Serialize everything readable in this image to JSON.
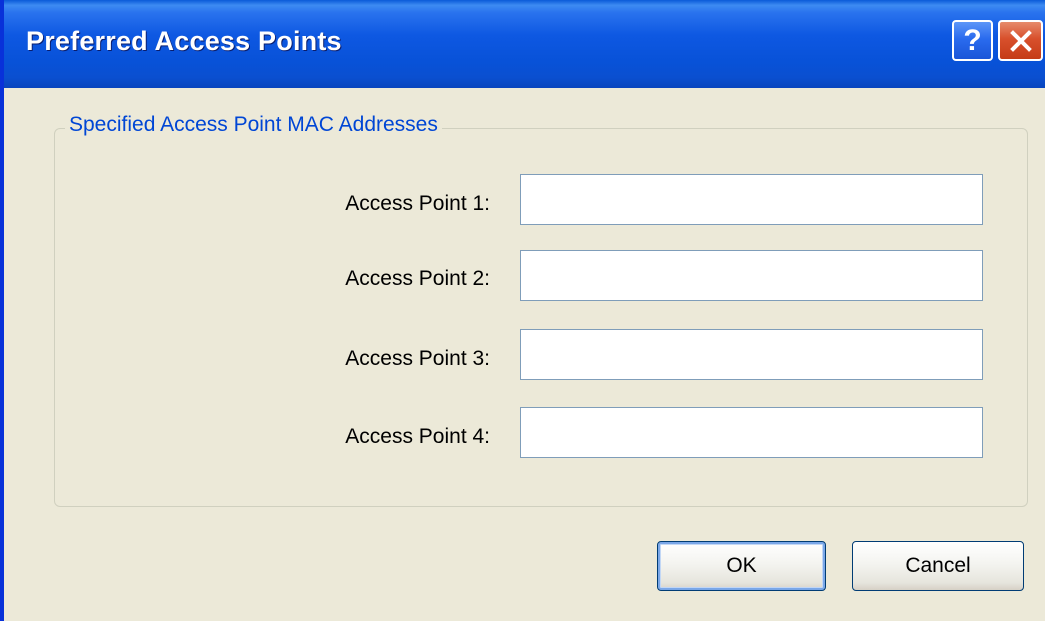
{
  "window": {
    "title": "Preferred Access Points",
    "help_glyph": "?",
    "help_icon": "question-mark-icon",
    "close_icon": "close-x-icon",
    "titlebar_color": "#0a55dc",
    "close_color": "#d8502c"
  },
  "group": {
    "legend": "Specified Access Point MAC Addresses",
    "legend_color": "#0046d5",
    "fields": [
      {
        "label": "Access Point 1:",
        "value": ""
      },
      {
        "label": "Access Point 2:",
        "value": ""
      },
      {
        "label": "Access Point 3:",
        "value": ""
      },
      {
        "label": "Access Point 4:",
        "value": ""
      }
    ]
  },
  "buttons": {
    "ok_label": "OK",
    "cancel_label": "Cancel"
  }
}
